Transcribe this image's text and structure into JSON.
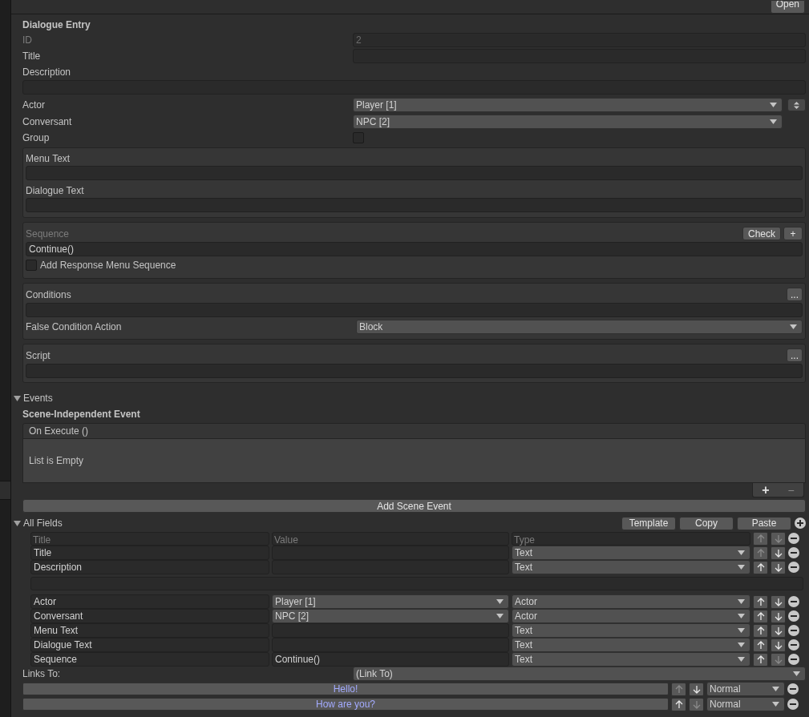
{
  "toolbar": {
    "button": "Open"
  },
  "entry": {
    "title": "Dialogue Entry",
    "id": {
      "label": "ID",
      "value": "2",
      "disabled": true
    },
    "title_field": {
      "label": "Title"
    },
    "description": {
      "label": "Description"
    },
    "actor": {
      "label": "Actor",
      "value": "Player [1]"
    },
    "conversant": {
      "label": "Conversant",
      "value": "NPC [2]"
    },
    "group": {
      "label": "Group",
      "checked": false
    }
  },
  "text_panel": {
    "fields": [
      {
        "label": "Menu Text"
      },
      {
        "label": "Dialogue Text"
      }
    ]
  },
  "sequence": {
    "label": "Sequence",
    "check_button": "Check",
    "add_button": "+",
    "value": "Continue()",
    "response_menu": {
      "label": "Add Response Menu Sequence",
      "checked": false
    }
  },
  "conditions": {
    "label": "Conditions",
    "button": "...",
    "false_action": {
      "label": "False Condition Action",
      "value": "Block"
    }
  },
  "script": {
    "label": "Script",
    "button": "..."
  },
  "events": {
    "label": "Events",
    "expanded": true,
    "subtitle": "Scene-Independent Event",
    "list_header": "On Execute ()",
    "empty_text": "List is Empty",
    "add": "+",
    "remove": "−",
    "add_button": "Add Scene Event"
  },
  "all_fields": {
    "label": "All Fields",
    "expanded": true,
    "buttons": [
      "Template",
      "Copy",
      "Paste"
    ],
    "columns": [
      {
        "title": "Title",
        "value": "Value",
        "type": "Type",
        "up_enabled": false,
        "down_enabled": false
      }
    ],
    "rows": [
      {
        "title": "Title",
        "kind": "text",
        "type": "Text",
        "up_enabled": false,
        "down_enabled": true,
        "extra_line": false
      },
      {
        "title": "Description",
        "kind": "text",
        "type": "Text",
        "up_enabled": true,
        "down_enabled": true,
        "extra_line": true
      },
      {
        "title": "Actor",
        "value": "Player [1]",
        "kind": "dropdown",
        "type": "Actor",
        "up_enabled": true,
        "down_enabled": true,
        "extra_line": false
      },
      {
        "title": "Conversant",
        "value": "NPC [2]",
        "kind": "dropdown",
        "type": "Actor",
        "up_enabled": true,
        "down_enabled": true,
        "extra_line": false
      },
      {
        "title": "Menu Text",
        "kind": "text",
        "type": "Text",
        "up_enabled": true,
        "down_enabled": true,
        "extra_line": false
      },
      {
        "title": "Dialogue Text",
        "kind": "text",
        "type": "Text",
        "up_enabled": true,
        "down_enabled": true,
        "extra_line": false
      },
      {
        "title": "Sequence",
        "value": "Continue()",
        "kind": "text",
        "type": "Text",
        "up_enabled": true,
        "down_enabled": false,
        "extra_line": false
      }
    ]
  },
  "links": {
    "label": "Links To:",
    "dropdown": "(Link To)",
    "items": [
      {
        "text": "Hello!",
        "up_enabled": false,
        "down_enabled": true,
        "priority": "Normal"
      },
      {
        "text": "How are you?",
        "up_enabled": true,
        "down_enabled": false,
        "priority": "Normal"
      }
    ]
  }
}
